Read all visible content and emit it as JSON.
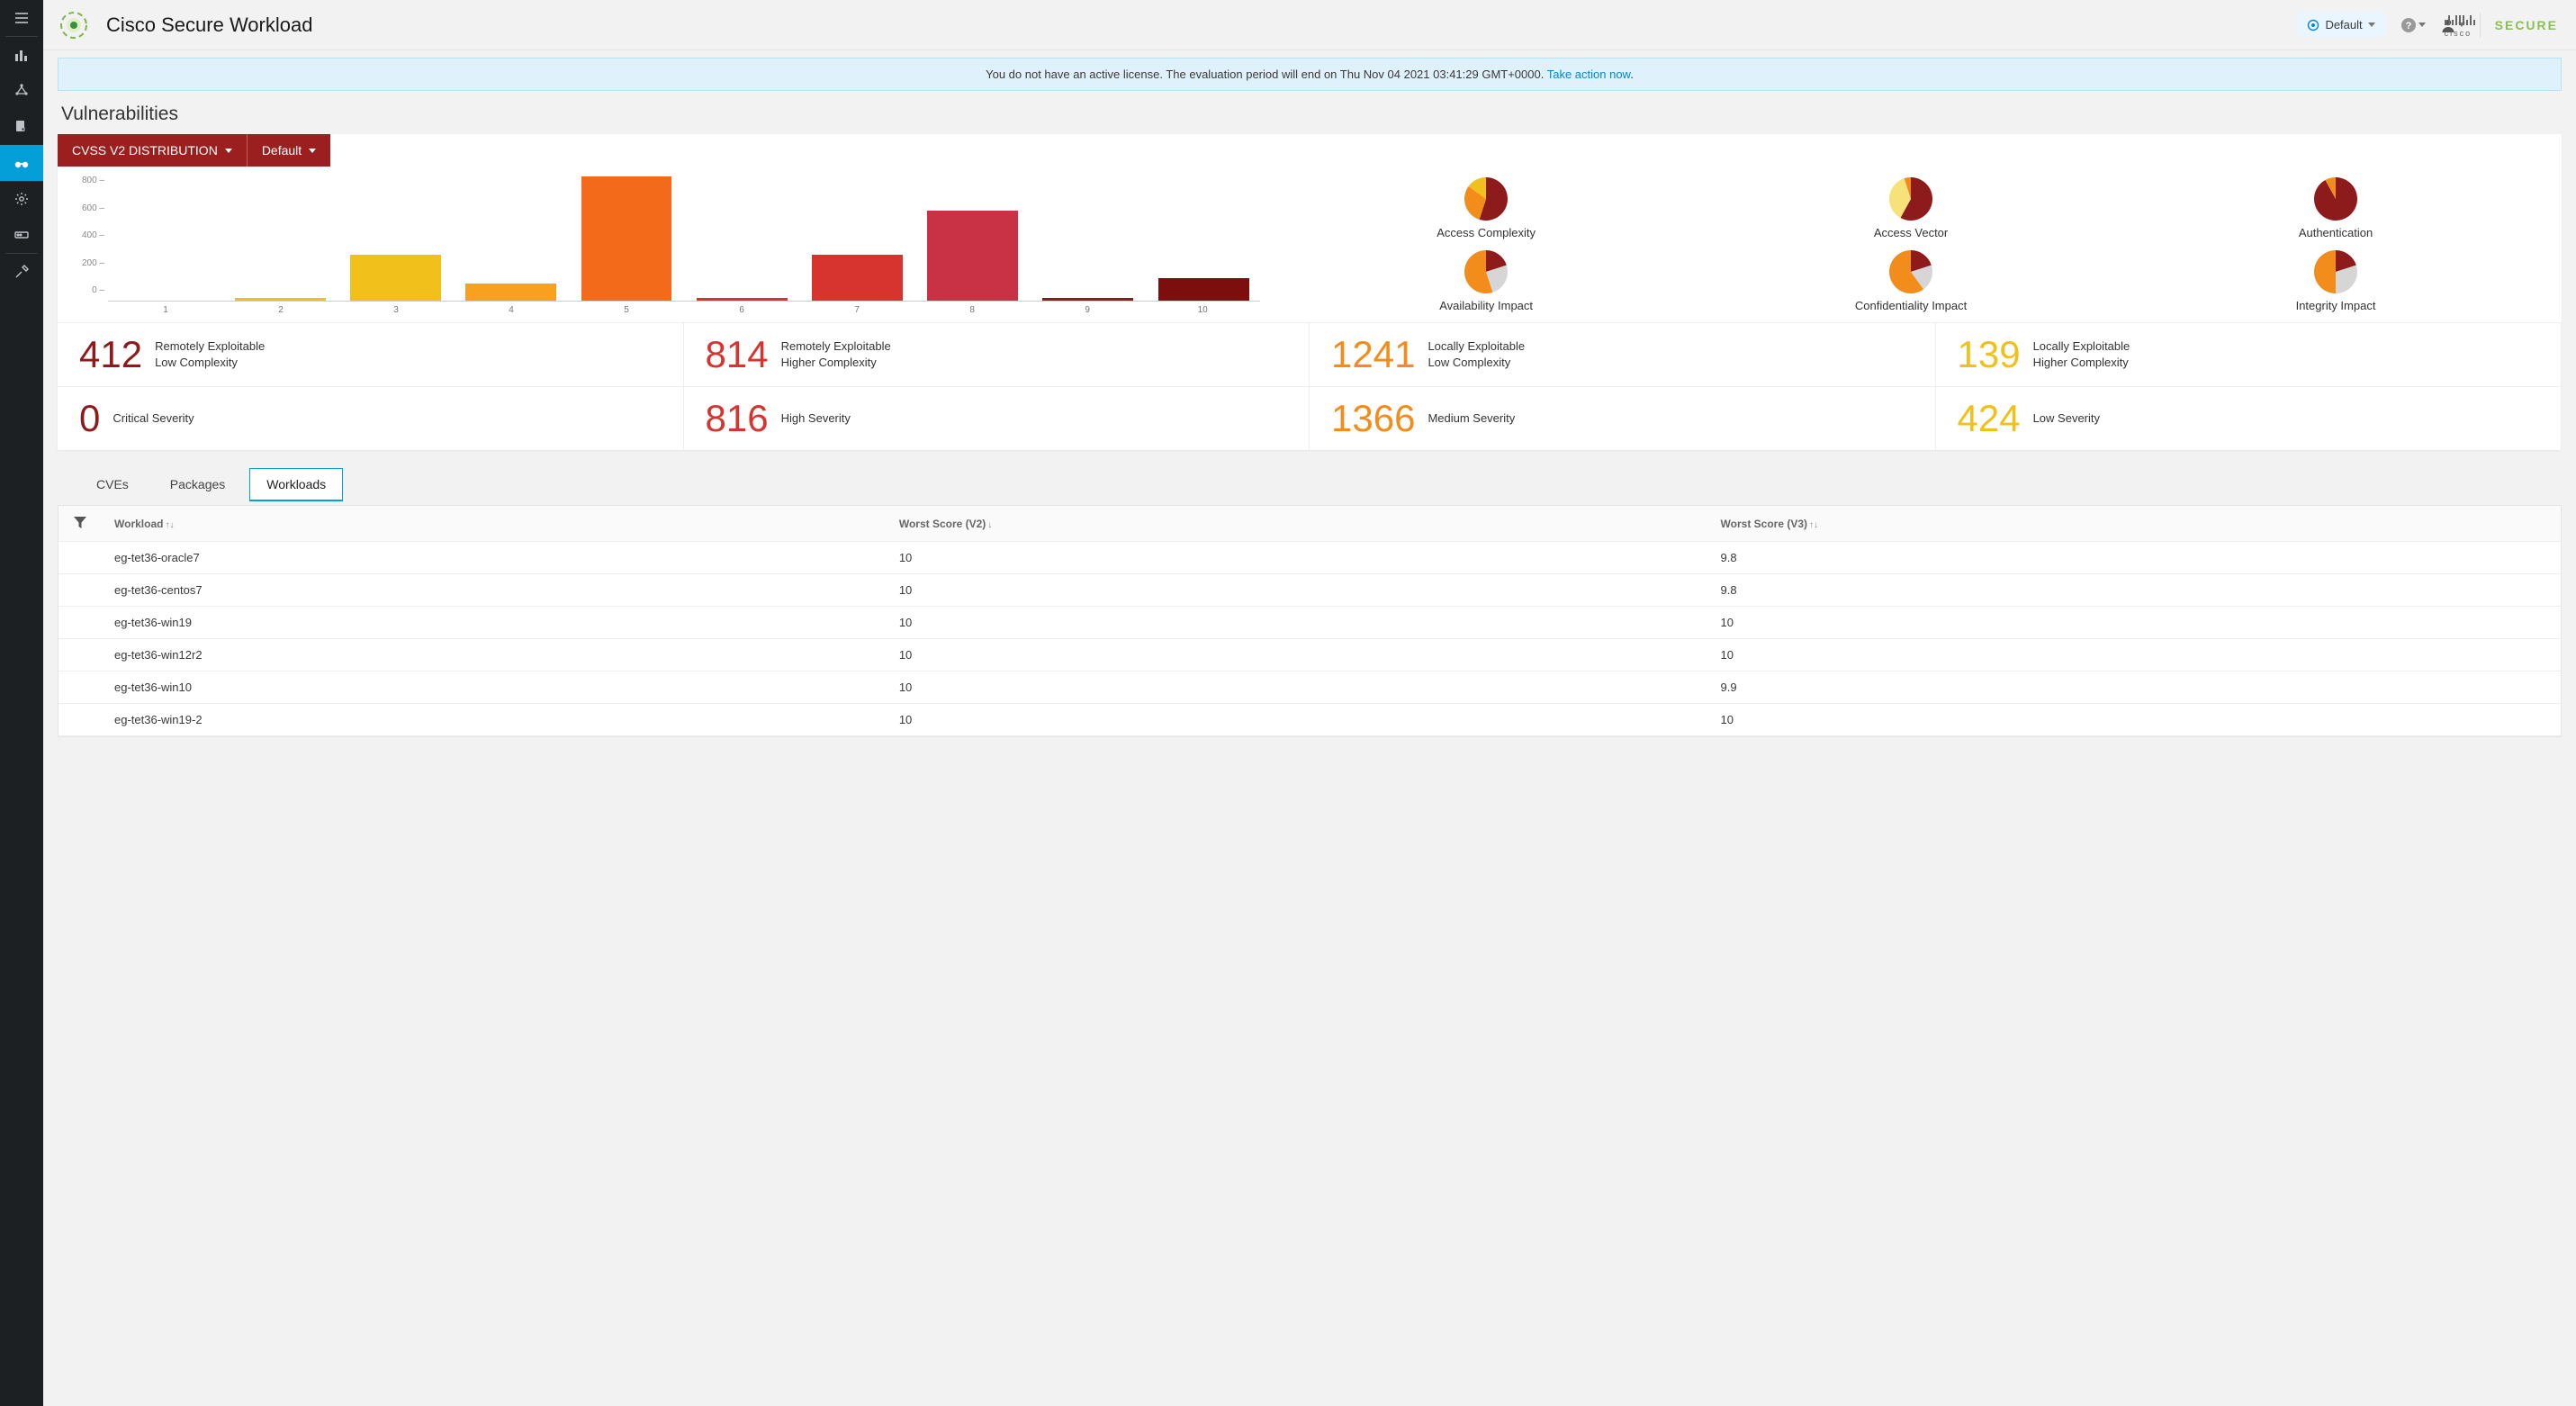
{
  "header": {
    "product": "Cisco Secure Workload",
    "scope_label": "Default",
    "secure_brand_prefix": "cisco",
    "secure_brand": "SECURE"
  },
  "banner": {
    "text": "You do not have an active license. The evaluation period will end on Thu Nov 04 2021 03:41:29 GMT+0000. ",
    "link": "Take action now"
  },
  "page_title": "Vulnerabilities",
  "distribution": {
    "metric": "CVSS V2 DISTRIBUTION",
    "scope": "Default"
  },
  "chart_data": {
    "type": "bar",
    "categories": [
      "1",
      "2",
      "3",
      "4",
      "5",
      "6",
      "7",
      "8",
      "9",
      "10"
    ],
    "values": [
      0,
      20,
      330,
      120,
      890,
      20,
      330,
      640,
      20,
      160
    ],
    "colors": [
      "#f2c01a",
      "#f2c01a",
      "#f2c01a",
      "#f7a11e",
      "#f26a1a",
      "#d7342f",
      "#d7342f",
      "#c83244",
      "#8e1b1b",
      "#7d0e0e"
    ],
    "ylim": [
      0,
      900
    ],
    "yticks": [
      800,
      600,
      400,
      200,
      0
    ]
  },
  "pies": [
    {
      "label": "Access Complexity",
      "slices": [
        {
          "c": "#8e1b1b",
          "v": 55
        },
        {
          "c": "#f28c1a",
          "v": 30
        },
        {
          "c": "#f2c01a",
          "v": 15
        }
      ]
    },
    {
      "label": "Access Vector",
      "slices": [
        {
          "c": "#8e1b1b",
          "v": 58
        },
        {
          "c": "#f7e27a",
          "v": 37
        },
        {
          "c": "#f28c1a",
          "v": 5
        }
      ]
    },
    {
      "label": "Authentication",
      "slices": [
        {
          "c": "#8e1b1b",
          "v": 92
        },
        {
          "c": "#f28c1a",
          "v": 8
        }
      ]
    },
    {
      "label": "Availability Impact",
      "slices": [
        {
          "c": "#8e1b1b",
          "v": 20
        },
        {
          "c": "#d6d6d6",
          "v": 25
        },
        {
          "c": "#f28c1a",
          "v": 55
        }
      ]
    },
    {
      "label": "Confidentiality Impact",
      "slices": [
        {
          "c": "#8e1b1b",
          "v": 20
        },
        {
          "c": "#d6d6d6",
          "v": 20
        },
        {
          "c": "#f28c1a",
          "v": 60
        }
      ]
    },
    {
      "label": "Integrity Impact",
      "slices": [
        {
          "c": "#8e1b1b",
          "v": 20
        },
        {
          "c": "#d6d6d6",
          "v": 30
        },
        {
          "c": "#f28c1a",
          "v": 50
        }
      ]
    }
  ],
  "stats": [
    {
      "n": "412",
      "l1": "Remotely Exploitable",
      "l2": "Low Complexity",
      "color": "c-dark"
    },
    {
      "n": "814",
      "l1": "Remotely Exploitable",
      "l2": "Higher Complexity",
      "color": "c-red"
    },
    {
      "n": "1241",
      "l1": "Locally Exploitable",
      "l2": "Low Complexity",
      "color": "c-orange"
    },
    {
      "n": "139",
      "l1": "Locally Exploitable",
      "l2": "Higher Complexity",
      "color": "c-yellow"
    },
    {
      "n": "0",
      "l1": "Critical Severity",
      "l2": "",
      "color": "c-dark"
    },
    {
      "n": "816",
      "l1": "High Severity",
      "l2": "",
      "color": "c-red"
    },
    {
      "n": "1366",
      "l1": "Medium Severity",
      "l2": "",
      "color": "c-orange"
    },
    {
      "n": "424",
      "l1": "Low Severity",
      "l2": "",
      "color": "c-yellow"
    }
  ],
  "tabs": {
    "cves": "CVEs",
    "packages": "Packages",
    "workloads": "Workloads",
    "active": "workloads"
  },
  "table": {
    "cols": {
      "workload": "Workload",
      "v2": "Worst Score (V2)",
      "v3": "Worst Score (V3)"
    },
    "rows": [
      {
        "w": "eg-tet36-oracle7",
        "v2": "10",
        "v3": "9.8"
      },
      {
        "w": "eg-tet36-centos7",
        "v2": "10",
        "v3": "9.8"
      },
      {
        "w": "eg-tet36-win19",
        "v2": "10",
        "v3": "10"
      },
      {
        "w": "eg-tet36-win12r2",
        "v2": "10",
        "v3": "10"
      },
      {
        "w": "eg-tet36-win10",
        "v2": "10",
        "v3": "9.9"
      },
      {
        "w": "eg-tet36-win19-2",
        "v2": "10",
        "v3": "10"
      }
    ]
  }
}
